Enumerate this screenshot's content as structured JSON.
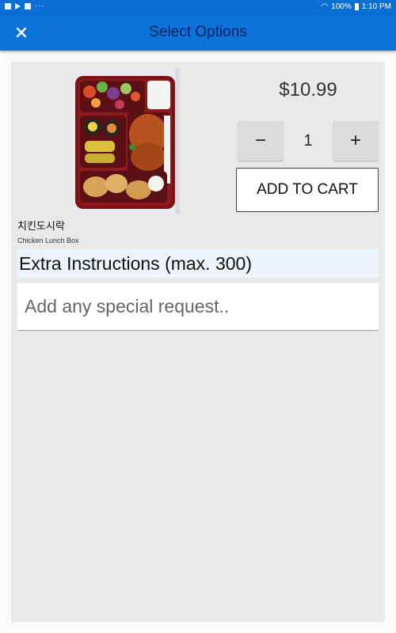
{
  "status_bar": {
    "battery": "100%",
    "time": "1:10 PM"
  },
  "app_bar": {
    "title": "Select Options",
    "close_icon": "close-icon"
  },
  "product": {
    "price": "$10.99",
    "quantity": "1",
    "minus_label": "−",
    "plus_label": "+",
    "add_to_cart_label": "ADD TO CART",
    "name_korean": "치킨도시락",
    "name_english": "Chicken Lunch Box",
    "image": "bento-box-photo"
  },
  "instructions": {
    "header": "Extra Instructions (max. 300)",
    "placeholder": "Add any special request..",
    "value": ""
  },
  "colors": {
    "app_bar": "#0a73d9",
    "title_text": "#0d1f5c",
    "panel": "#e9e9e9",
    "instructions_header_bg": "#edf4fb"
  }
}
